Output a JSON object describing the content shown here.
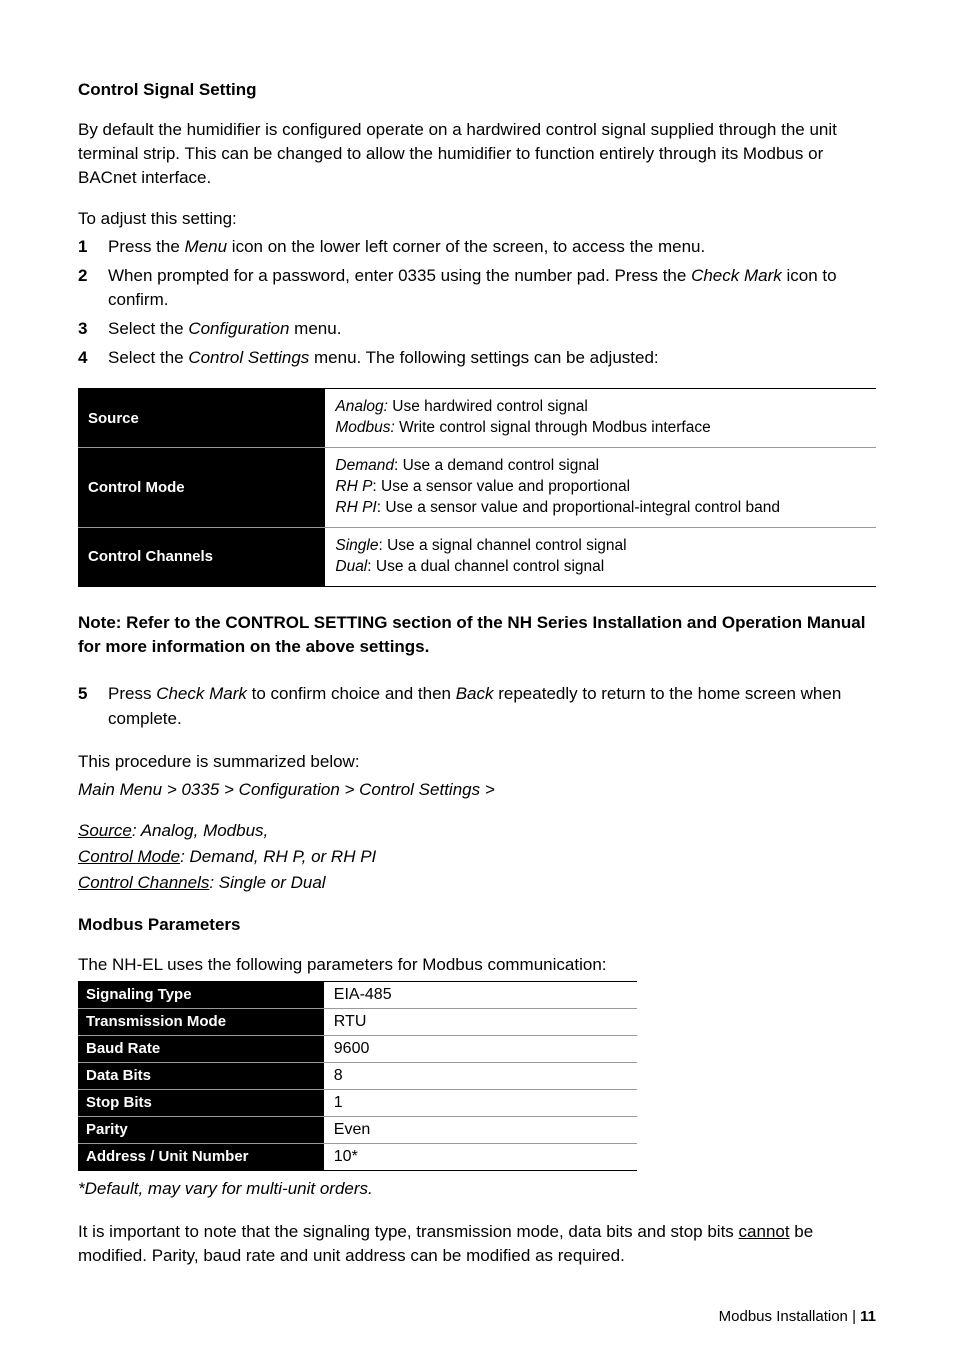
{
  "heading1": "Control Signal Setting",
  "intro_para": "By default the humidifier is configured operate on a hardwired control signal supplied through the unit terminal strip.  This can be changed to allow the humidifier to function entirely through its Modbus or BACnet interface.",
  "adjust_intro": "To adjust this setting:",
  "steps": [
    {
      "num": "1",
      "pre": "Press the ",
      "em": "Menu",
      "post": " icon on the lower left corner of the screen, to access the menu."
    },
    {
      "num": "2",
      "pre": "When prompted for a password, enter 0335 using the number pad. Press the ",
      "em": "Check Mark",
      "post": " icon to confirm."
    },
    {
      "num": "3",
      "pre": "Select the ",
      "em": "Configuration",
      "post": " menu."
    },
    {
      "num": "4",
      "pre": "Select the ",
      "em": "Control Settings",
      "post": " menu.  The following settings can be adjusted:"
    }
  ],
  "settings_table": [
    {
      "label": "Source",
      "lines": [
        {
          "em": "Analog:",
          "rest": "  Use hardwired control signal"
        },
        {
          "em": "Modbus:",
          "rest": " Write control signal through Modbus interface"
        }
      ]
    },
    {
      "label": "Control Mode",
      "lines": [
        {
          "em": "Demand",
          "rest": ": Use a demand control signal"
        },
        {
          "em": "RH P",
          "rest": ": Use a sensor value and proportional"
        },
        {
          "em": "RH PI",
          "rest": ": Use a sensor value and proportional-integral control band"
        }
      ]
    },
    {
      "label": "Control Channels",
      "lines": [
        {
          "em": "Single",
          "rest": ": Use a signal channel control signal"
        },
        {
          "em": "Dual",
          "rest": ": Use a dual channel control signal"
        }
      ]
    }
  ],
  "note": "Note: Refer to the CONTROL SETTING section of the NH Series Installation and Operation Manual for more information on the above settings.",
  "step5": {
    "num": "5",
    "pre": "Press ",
    "em1": "Check Mark",
    "mid": " to confirm choice and then ",
    "em2": "Back",
    "post": " repeatedly to return to the home screen when complete."
  },
  "summary_intro": "This procedure is summarized below:",
  "summary_path": "Main Menu > 0335 > Configuration > Control Settings >",
  "summary_lines": [
    {
      "u": "Source",
      "rest": ": Analog, Modbus,"
    },
    {
      "u": "Control Mode",
      "rest": ": Demand, RH P, or RH PI"
    },
    {
      "u": "Control Channels",
      "rest": ": Single or Dual"
    }
  ],
  "heading2": "Modbus Parameters",
  "modbus_intro": "The NH-EL uses the following parameters for Modbus communication:",
  "params_table": [
    {
      "label": "Signaling Type",
      "value": "EIA-485"
    },
    {
      "label": "Transmission Mode",
      "value": "RTU"
    },
    {
      "label": "Baud Rate",
      "value": "9600"
    },
    {
      "label": "Data Bits",
      "value": "8"
    },
    {
      "label": "Stop Bits",
      "value": "1"
    },
    {
      "label": "Parity",
      "value": "Even"
    },
    {
      "label": "Address / Unit Number",
      "value": "10*"
    }
  ],
  "asterisk_note": "*Default, may vary for multi-unit orders.",
  "closing_para_pre": "It is important to note that the signaling type, transmission mode, data bits and stop bits ",
  "closing_para_u": "cannot",
  "closing_para_post": " be modified.  Parity, baud rate and unit address can be modified as required.",
  "footer_text": "Modbus Installation | ",
  "footer_page": "11"
}
